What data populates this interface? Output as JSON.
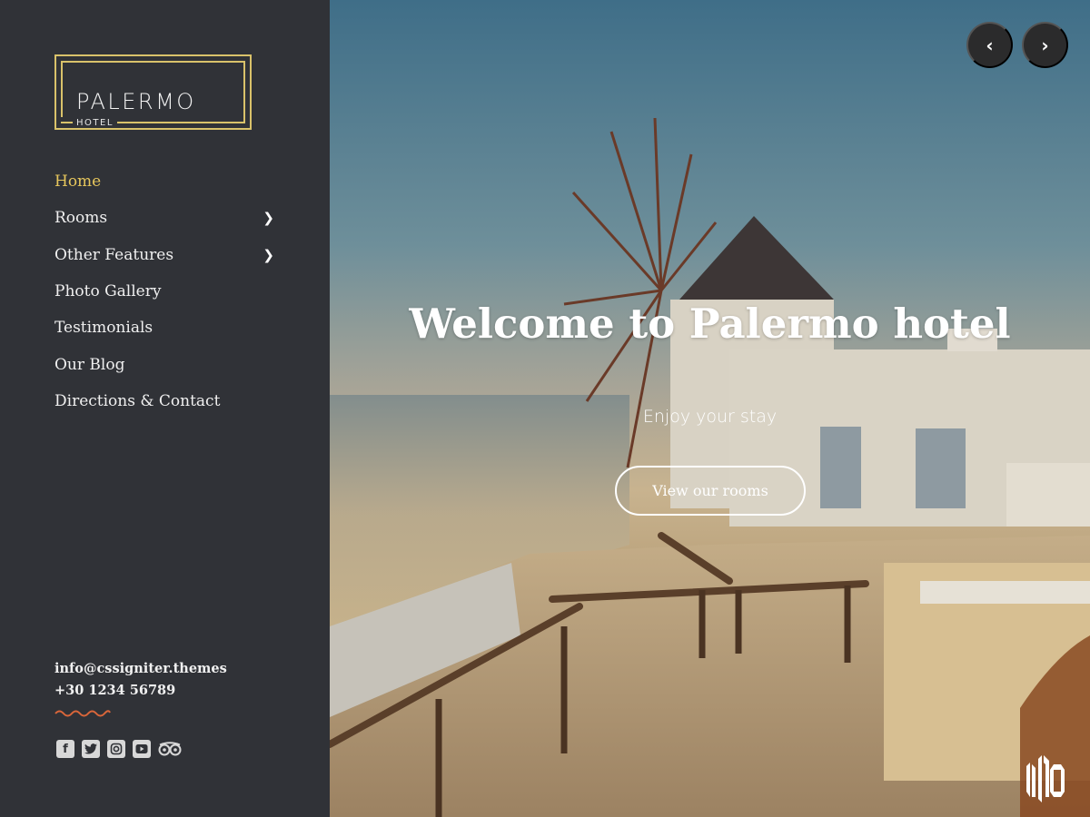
{
  "brand": {
    "name": "PALERMO",
    "subtitle": "HOTEL",
    "accent_color": "#d9c26a"
  },
  "nav": {
    "items": [
      {
        "label": "Home",
        "active": true,
        "has_submenu": false
      },
      {
        "label": "Rooms",
        "active": false,
        "has_submenu": true
      },
      {
        "label": "Other Features",
        "active": false,
        "has_submenu": true
      },
      {
        "label": "Photo Gallery",
        "active": false,
        "has_submenu": false
      },
      {
        "label": "Testimonials",
        "active": false,
        "has_submenu": false
      },
      {
        "label": "Our Blog",
        "active": false,
        "has_submenu": false
      },
      {
        "label": "Directions & Contact",
        "active": false,
        "has_submenu": false
      }
    ],
    "submenu_icon": "chevron-right-icon"
  },
  "contact": {
    "email": "info@cssigniter.themes",
    "phone": "+30 1234 56789",
    "divider_color": "#d9663a"
  },
  "social": [
    {
      "name": "facebook-icon",
      "glyph": "f"
    },
    {
      "name": "twitter-icon",
      "glyph": "t"
    },
    {
      "name": "instagram-icon",
      "glyph": "◎"
    },
    {
      "name": "youtube-icon",
      "glyph": "▶"
    },
    {
      "name": "tripadvisor-icon",
      "glyph": "oo"
    }
  ],
  "hero": {
    "title": "Welcome to Palermo hotel",
    "tagline": "Enjoy your stay",
    "cta_label": "View our rooms",
    "prev_glyph": "‹",
    "next_glyph": "›",
    "watermark": "MMO"
  }
}
